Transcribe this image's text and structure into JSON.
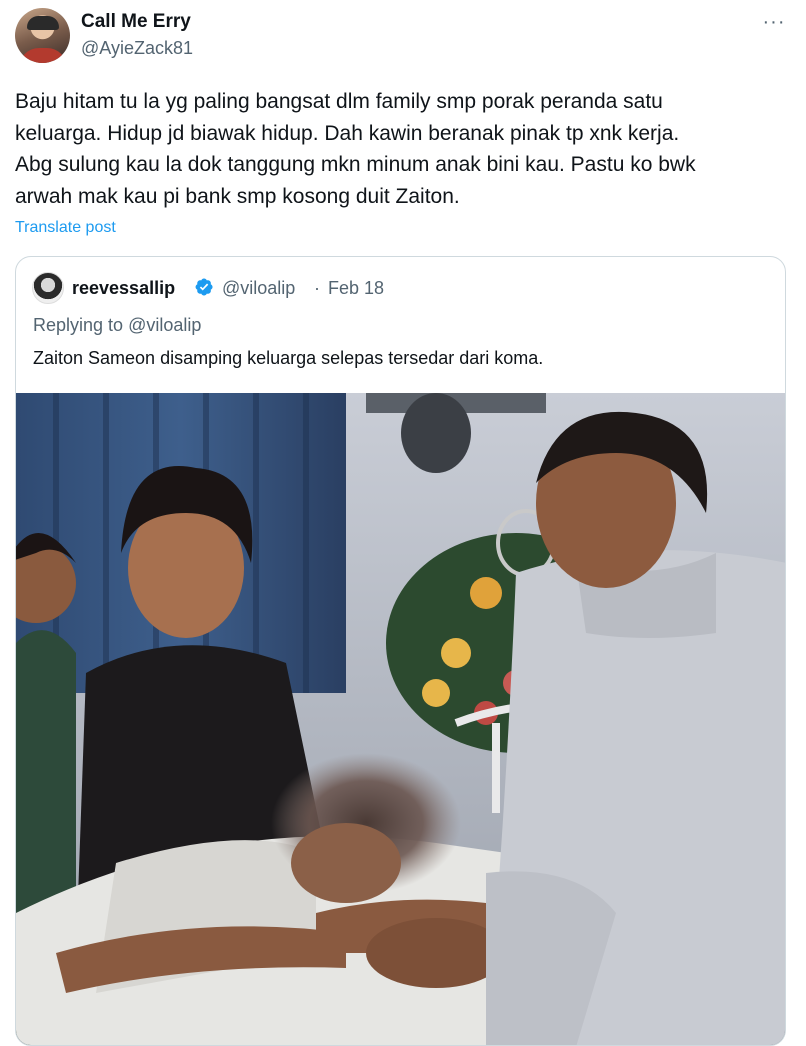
{
  "author": {
    "display_name": "Call Me Erry",
    "handle": "@AyieZack81",
    "avatar_icon": "profile-avatar"
  },
  "post": {
    "text": "Baju hitam tu la yg paling bangsat dlm family smp porak peranda satu\nkeluarga. Hidup jd biawak hidup. Dah kawin beranak pinak tp xnk kerja.\nAbg sulung kau la dok tanggung mkn minum anak bini kau. Pastu ko bwk\narwah mak kau pi bank smp kosong duit Zaiton.",
    "translate_label": "Translate post",
    "more_label": "···"
  },
  "quoted": {
    "display_name": "reevessallip",
    "verified": true,
    "handle": "@viloalip",
    "separator": "·",
    "date": "Feb 18",
    "replying_prefix": "Replying to ",
    "replying_to": "@viloalip",
    "text": "Zaiton Sameon disamping keluarga selepas tersedar dari koma.",
    "media_icon": "photo-media"
  },
  "colors": {
    "text": "#0f1419",
    "secondary": "#536471",
    "link": "#1d9bf0",
    "border": "#cfd9de",
    "verified": "#1d9bf0"
  }
}
